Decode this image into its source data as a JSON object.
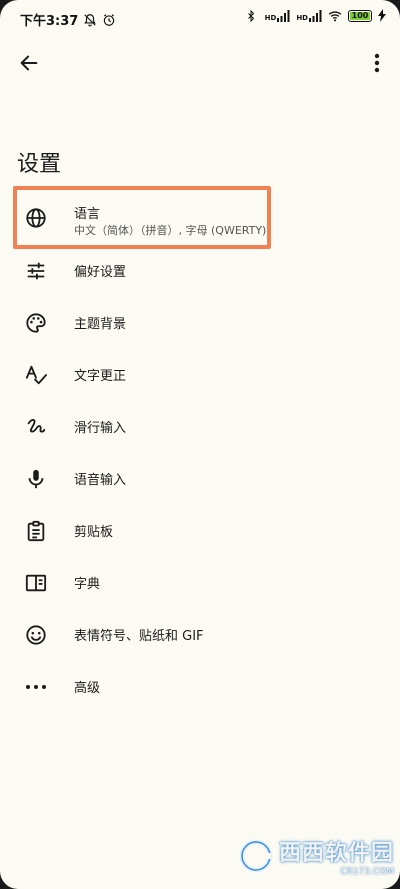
{
  "status_bar": {
    "time": "下午3:37",
    "sim1_label": "HD",
    "sim2_label": "HD",
    "battery_text": "100",
    "battery_level": 1.0,
    "battery_color": "#7acd33"
  },
  "header": {
    "title": "设置"
  },
  "items": [
    {
      "label": "语言",
      "sublabel": "中文（简体）（拼音）, 字母 (QWERTY)",
      "icon": "globe-icon"
    },
    {
      "label": "偏好设置",
      "icon": "sliders-icon"
    },
    {
      "label": "主题背景",
      "icon": "palette-icon"
    },
    {
      "label": "文字更正",
      "icon": "spellcheck-icon"
    },
    {
      "label": "滑行输入",
      "icon": "gesture-icon"
    },
    {
      "label": "语音输入",
      "icon": "microphone-icon"
    },
    {
      "label": "剪贴板",
      "icon": "clipboard-icon"
    },
    {
      "label": "字典",
      "icon": "book-icon"
    },
    {
      "label": "表情符号、贴纸和 GIF",
      "icon": "emoji-icon"
    },
    {
      "label": "高级",
      "icon": "more-horizontal-icon"
    }
  ],
  "highlight_color": "#f08152",
  "watermark": {
    "main": "西西软件园",
    "sub": "CR173.COM"
  }
}
